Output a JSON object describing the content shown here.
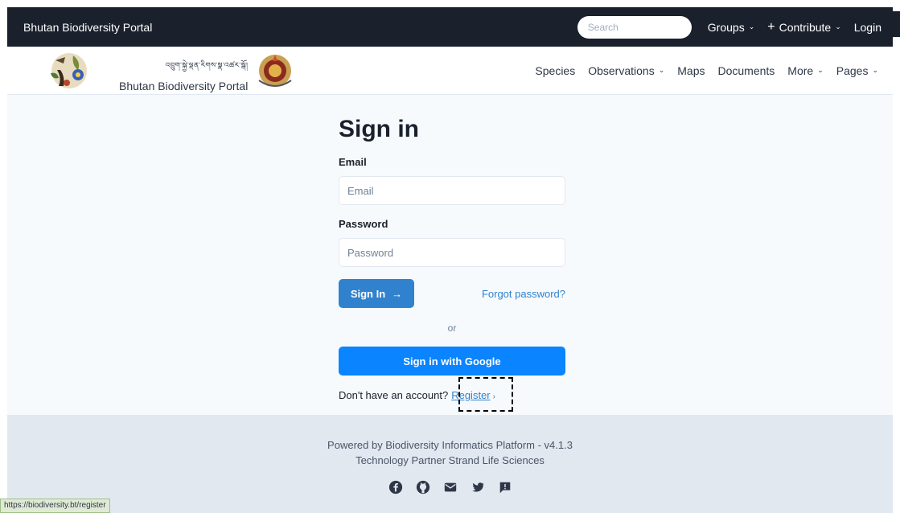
{
  "topbar": {
    "brand": "Bhutan Biodiversity Portal",
    "search_placeholder": "Search",
    "groups": "Groups",
    "contribute": "Contribute",
    "login": "Login"
  },
  "navbar": {
    "tibetan": "འབྲུག་སྐྱེ་ལྡན་རིགས་སྣ་འཚར་སྒོ།",
    "portal_name": "Bhutan Biodiversity Portal",
    "items": [
      "Species",
      "Observations",
      "Maps",
      "Documents",
      "More",
      "Pages"
    ]
  },
  "form": {
    "title": "Sign in",
    "email_label": "Email",
    "email_placeholder": "Email",
    "password_label": "Password",
    "password_placeholder": "Password",
    "signin_button": "Sign In",
    "forgot": "Forgot password?",
    "or": "or",
    "google_button": "Sign in with Google",
    "no_account": "Don't have an account?",
    "register": "Register"
  },
  "footer": {
    "line1": "Powered by Biodiversity Informatics Platform - v4.1.3",
    "line2": "Technology Partner Strand Life Sciences",
    "socials": [
      "facebook-icon",
      "github-icon",
      "mail-icon",
      "twitter-icon",
      "feedback-icon"
    ]
  },
  "status_url": "https://biodiversity.bt/register",
  "colors": {
    "topbar": "#1a202c",
    "primary": "#3182ce",
    "google": "#0a84ff",
    "footer": "#e2e8f0"
  }
}
